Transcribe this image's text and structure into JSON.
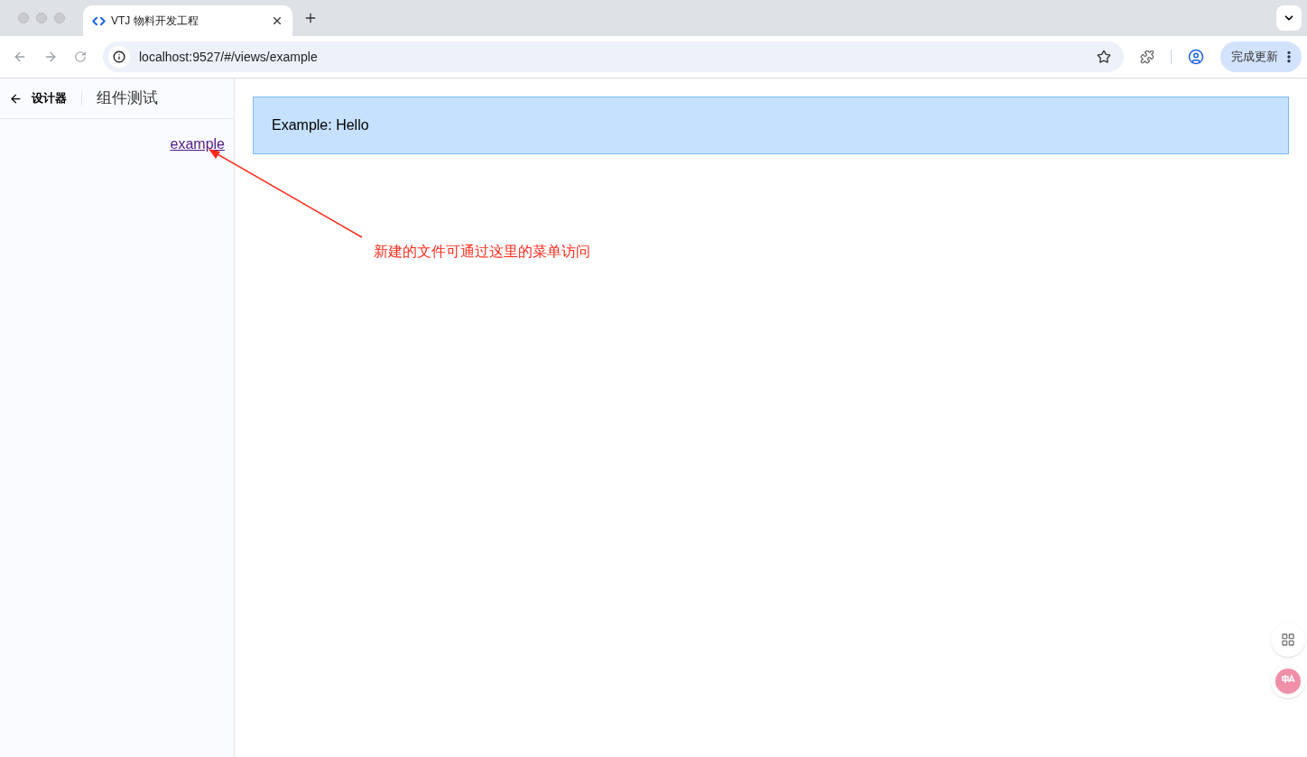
{
  "browser": {
    "tab_title": "VTJ 物料开发工程",
    "url": "localhost:9527/#/views/example",
    "update_button": "完成更新"
  },
  "sidebar": {
    "back_label": "设计器",
    "title": "组件测试",
    "items": [
      {
        "label": "example"
      }
    ]
  },
  "content": {
    "text": "Example: Hello"
  },
  "annotation": {
    "text": "新建的文件可通过这里的菜单访问"
  }
}
